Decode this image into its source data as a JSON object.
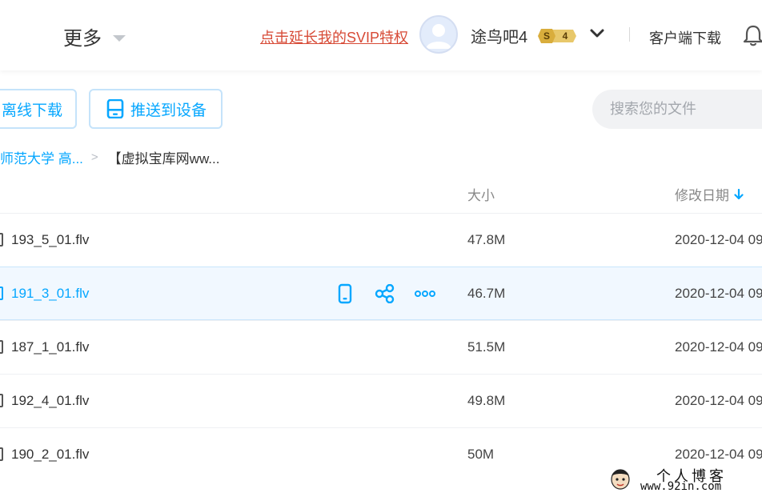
{
  "header": {
    "more_label": "更多",
    "svip_link": "点击延长我的SVIP特权",
    "username": "途鸟吧4",
    "badge_s": "S",
    "badge_level": "4",
    "client_download": "客户端下载"
  },
  "toolbar": {
    "offline_download": "离线下载",
    "push_to_device": "推送到设备",
    "search_placeholder": "搜索您的文件"
  },
  "breadcrumb": {
    "parent": "师范大学 高...",
    "separator": ">",
    "current": "【虚拟宝库网ww..."
  },
  "table": {
    "col_size": "大小",
    "col_modified": "修改日期",
    "rows": [
      {
        "name": "193_5_01.flv",
        "size": "47.8M",
        "date": "2020-12-04 09"
      },
      {
        "name": "191_3_01.flv",
        "size": "46.7M",
        "date": "2020-12-04 09"
      },
      {
        "name": "187_1_01.flv",
        "size": "51.5M",
        "date": "2020-12-04 09"
      },
      {
        "name": "192_4_01.flv",
        "size": "49.8M",
        "date": "2020-12-04 09"
      },
      {
        "name": "190_2_01.flv",
        "size": "50M",
        "date": "2020-12-04 09"
      }
    ]
  },
  "watermark": {
    "title": "个人博客",
    "url": "www.92in.com"
  },
  "colors": {
    "accent": "#06a7ff",
    "svip_link": "#d74a36",
    "hover_row": "#f1f8ff"
  }
}
